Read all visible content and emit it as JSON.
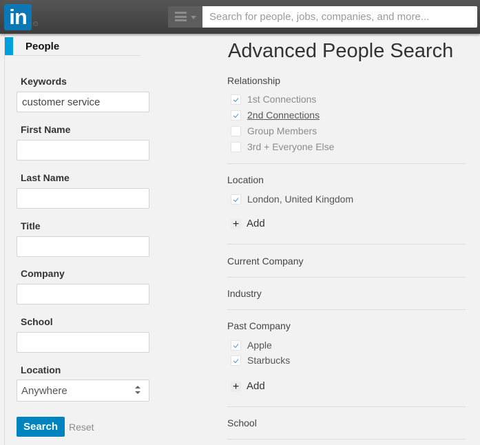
{
  "header": {
    "logo_text": "in",
    "registered_mark": "®",
    "search_placeholder": "Search for people, jobs, companies, and more...",
    "menu_icon": "hamburger-menu-icon"
  },
  "sidebar": {
    "tab_label": "People",
    "accent_color": "#00a0dc",
    "fields": [
      {
        "label": "Keywords",
        "value": "customer service"
      },
      {
        "label": "First Name",
        "value": ""
      },
      {
        "label": "Last Name",
        "value": ""
      },
      {
        "label": "Title",
        "value": ""
      },
      {
        "label": "Company",
        "value": ""
      },
      {
        "label": "School",
        "value": ""
      }
    ],
    "location": {
      "label": "Location",
      "selected": "Anywhere"
    },
    "search_button": "Search",
    "reset_link": "Reset",
    "button_color": "#0084bf"
  },
  "main": {
    "title": "Advanced People Search",
    "relationship": {
      "title": "Relationship",
      "options": [
        {
          "label": "1st Connections",
          "checked": true
        },
        {
          "label": "2nd Connections",
          "checked": true
        },
        {
          "label": "Group Members",
          "checked": false
        },
        {
          "label": "3rd + Everyone Else",
          "checked": false
        }
      ]
    },
    "location": {
      "title": "Location",
      "options": [
        {
          "label": "London, United Kingdom",
          "checked": true
        }
      ],
      "add_label": "Add"
    },
    "current_company": {
      "title": "Current Company"
    },
    "industry": {
      "title": "Industry"
    },
    "past_company": {
      "title": "Past Company",
      "options": [
        {
          "label": "Apple",
          "checked": true
        },
        {
          "label": "Starbucks",
          "checked": true
        }
      ],
      "add_label": "Add"
    },
    "school": {
      "title": "School"
    }
  }
}
